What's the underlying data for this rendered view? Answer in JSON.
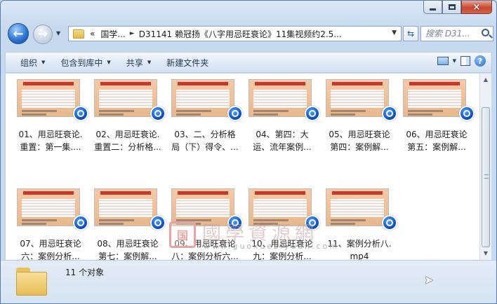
{
  "window": {
    "caption": {
      "minimize": "minimize",
      "maximize": "maximize",
      "close": "×"
    }
  },
  "nav": {
    "back_glyph": "←",
    "forward_glyph": "→",
    "breadcrumb": [
      "«",
      "国学...",
      "D31141 赖冠扬《八字用忌旺衰论》11集视频约2.5..."
    ],
    "search_placeholder": "搜索 D31..."
  },
  "toolbar": {
    "organize": "组织",
    "include_in_library": "包含到库中",
    "share": "共享",
    "new_folder": "新建文件夹"
  },
  "files": [
    {
      "line1": "01、用忌旺衰论.",
      "line2": "重置：第一集...."
    },
    {
      "line1": "02、用忌旺衰论.",
      "line2": "重置二：分析格..."
    },
    {
      "line1": "03、二、分析格",
      "line2": "局（下）得令、..."
    },
    {
      "line1": "04、第四：大",
      "line2": "运、流年案例..."
    },
    {
      "line1": "05、用忌旺衰论",
      "line2": "第四：案例解..."
    },
    {
      "line1": "06、用忌旺衰论",
      "line2": "第五：案例解..."
    },
    {
      "line1": "07、用忌旺衰论",
      "line2": "六：案例分析..."
    },
    {
      "line1": "08、用忌旺衰论",
      "line2": "第七：案例解..."
    },
    {
      "line1": "09、用忌旺衰论",
      "line2": "八：案例分析六..."
    },
    {
      "line1": "10、用忌旺衰论",
      "line2": "九：案例分析..."
    },
    {
      "line1": "11、案例分析八.",
      "line2": "mp4"
    }
  ],
  "watermark": {
    "seal": "国",
    "title": "國學資源網",
    "url": "www.guoxueziyuan.com"
  },
  "status": {
    "count": "11 个对象"
  }
}
